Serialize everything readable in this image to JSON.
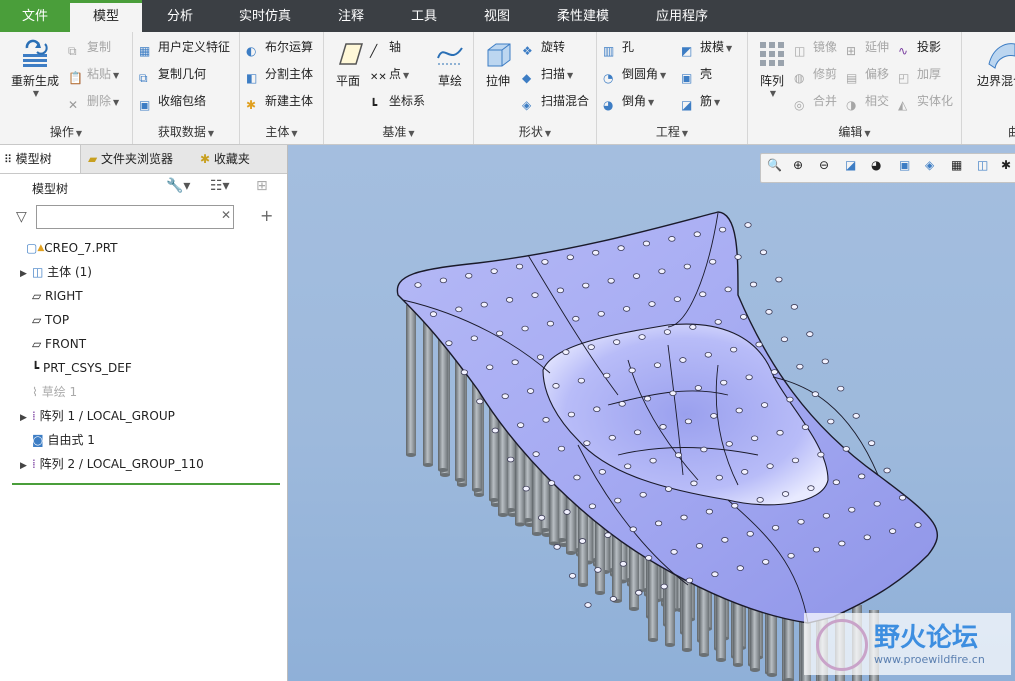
{
  "menu": {
    "tabs": [
      "文件",
      "模型",
      "分析",
      "实时仿真",
      "注释",
      "工具",
      "视图",
      "柔性建模",
      "应用程序"
    ],
    "active": "模型"
  },
  "ribbon": {
    "ops": {
      "label": "操作",
      "regen": "重新生成",
      "copy": "复制",
      "paste": "粘贴",
      "delete": "删除"
    },
    "getdata": {
      "label": "获取数据",
      "udf": "用户定义特征",
      "copygeom": "复制几何",
      "shrinkwrap": "收缩包络"
    },
    "body": {
      "label": "主体",
      "boolean": "布尔运算",
      "split": "分割主体",
      "newbody": "新建主体"
    },
    "datum": {
      "label": "基准",
      "plane": "平面",
      "axis": "轴",
      "point": "点",
      "csys": "坐标系",
      "sketch": "草绘"
    },
    "shapes": {
      "label": "形状",
      "extrude": "拉伸",
      "revolve": "旋转",
      "sweep": "扫描",
      "sweptblend": "扫描混合"
    },
    "engineering": {
      "label": "工程",
      "hole": "孔",
      "round": "倒圆角",
      "chamfer": "倒角",
      "draft": "拔模",
      "shell": "壳",
      "rib": "筋"
    },
    "editing": {
      "label": "编辑",
      "pattern": "阵列",
      "mirror": "镜像",
      "extend": "延伸",
      "project": "投影",
      "trim": "修剪",
      "offset": "偏移",
      "thicken": "加厚",
      "merge": "合并",
      "intersect": "相交",
      "solidify": "实体化"
    },
    "surfaces": {
      "label": "曲",
      "boundary": "边界混合"
    }
  },
  "nav": {
    "tabs": [
      "模型树",
      "文件夹浏览器",
      "收藏夹"
    ],
    "tree_title": "模型树",
    "search_placeholder": "",
    "items": [
      {
        "label": "CREO_7.PRT",
        "expand": false
      },
      {
        "label": "主体 (1)",
        "expand": true
      },
      {
        "label": "RIGHT",
        "expand": false
      },
      {
        "label": "TOP",
        "expand": false
      },
      {
        "label": "FRONT",
        "expand": false
      },
      {
        "label": "PRT_CSYS_DEF",
        "expand": false
      },
      {
        "label": "草绘 1",
        "expand": false
      },
      {
        "label": "阵列 1 / LOCAL_GROUP",
        "expand": true
      },
      {
        "label": "自由式 1",
        "expand": false
      },
      {
        "label": "阵列 2 / LOCAL_GROUP_110",
        "expand": true
      }
    ]
  },
  "watermark": {
    "title": "野火论坛",
    "url": "www.proewildfire.cn"
  },
  "colors": {
    "accent": "#4a9e3a",
    "menubar": "#3b3f44",
    "surface": "#a6aaf2",
    "viewport": "#9db9dc"
  }
}
